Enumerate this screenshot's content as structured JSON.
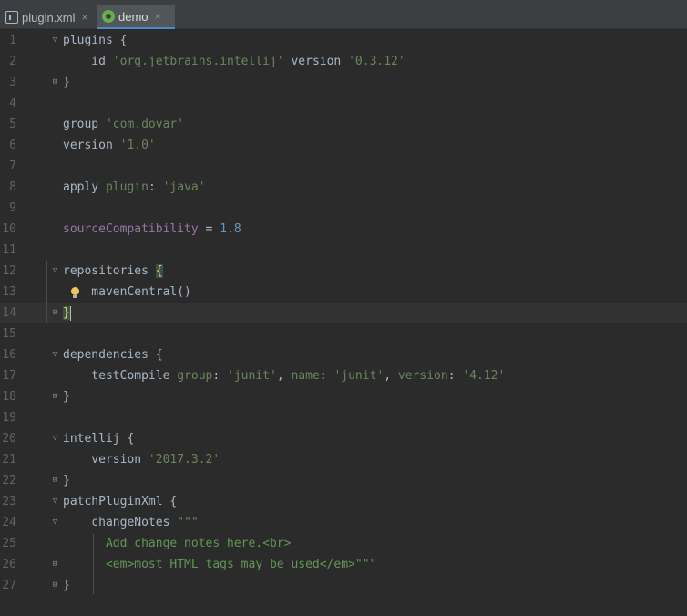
{
  "tabs": [
    {
      "label": "plugin.xml",
      "icon": "xml-file-icon",
      "close": "×"
    },
    {
      "label": "demo",
      "icon": "gradle-file-icon",
      "close": "×"
    }
  ],
  "editor": {
    "line_numbers": [
      "1",
      "2",
      "3",
      "4",
      "5",
      "6",
      "7",
      "8",
      "9",
      "10",
      "11",
      "12",
      "13",
      "14",
      "15",
      "16",
      "17",
      "18",
      "19",
      "20",
      "21",
      "22",
      "23",
      "24",
      "25",
      "26",
      "27"
    ],
    "code": {
      "l1": {
        "ident": "plugins",
        "brace": " {"
      },
      "l2": {
        "ident": "    id ",
        "str": "'org.jetbrains.intellij'",
        "ident2": " version ",
        "str2": "'0.3.12'"
      },
      "l3": {
        "brace": "}"
      },
      "l5": {
        "ident": "group ",
        "str": "'com.dovar'"
      },
      "l6": {
        "ident": "version ",
        "str": "'1.0'"
      },
      "l8": {
        "ident": "apply ",
        "named": "plugin",
        "colon": ": ",
        "str": "'java'"
      },
      "l10": {
        "prop": "sourceCompatibility",
        "op": " = ",
        "num": "1.8"
      },
      "l12": {
        "ident": "repositories ",
        "brace": "{"
      },
      "l13": {
        "ident": "    mavenCentral()"
      },
      "l14": {
        "brace": "}"
      },
      "l16": {
        "ident": "dependencies {"
      },
      "l17": {
        "ident": "    testCompile ",
        "n1": "group",
        "c1": ": ",
        "s1": "'junit'",
        "c2": ", ",
        "n2": "name",
        "c3": ": ",
        "s2": "'junit'",
        "c4": ", ",
        "n3": "version",
        "c5": ": ",
        "s3": "'4.12'"
      },
      "l18": {
        "brace": "}"
      },
      "l20": {
        "ident": "intellij {"
      },
      "l21": {
        "ident": "    version ",
        "str": "'2017.3.2'"
      },
      "l22": {
        "brace": "}"
      },
      "l23": {
        "ident": "patchPluginXml {"
      },
      "l24": {
        "ident": "    changeNotes ",
        "str": "\"\"\""
      },
      "l25": {
        "str": "      Add change notes here.<br>"
      },
      "l26": {
        "str": "      <em>most HTML tags may be used</em>\"\"\""
      },
      "l27": {
        "brace": "}"
      }
    }
  }
}
